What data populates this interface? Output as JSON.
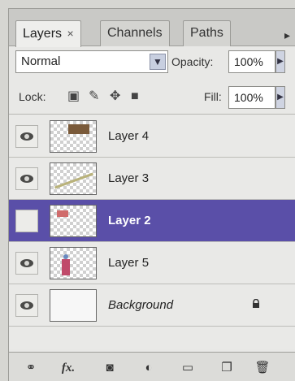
{
  "tabs": [
    {
      "label": "Layers",
      "close": "×",
      "active": true
    },
    {
      "label": "Channels",
      "active": false
    },
    {
      "label": "Paths",
      "active": false
    }
  ],
  "blend_mode": "Normal",
  "opacity": {
    "label": "Opacity:",
    "value": "100%"
  },
  "lock": {
    "label": "Lock:"
  },
  "fill": {
    "label": "Fill:",
    "value": "100%"
  },
  "layers": [
    {
      "name": "Layer 4",
      "visible": true,
      "selected": false
    },
    {
      "name": "Layer 3",
      "visible": true,
      "selected": false
    },
    {
      "name": "Layer 2",
      "visible": false,
      "selected": true
    },
    {
      "name": "Layer 5",
      "visible": true,
      "selected": false
    },
    {
      "name": "Background",
      "visible": true,
      "selected": false,
      "locked": true
    }
  ],
  "bottom_icons": [
    "link-icon",
    "fx-icon",
    "mask-icon",
    "adjustment-icon",
    "folder-icon",
    "new-layer-icon",
    "trash-icon"
  ],
  "bottom_fx_label": "fx.",
  "colors": {
    "selection": "#5a4fa8",
    "panel": "#e8e8e6"
  }
}
